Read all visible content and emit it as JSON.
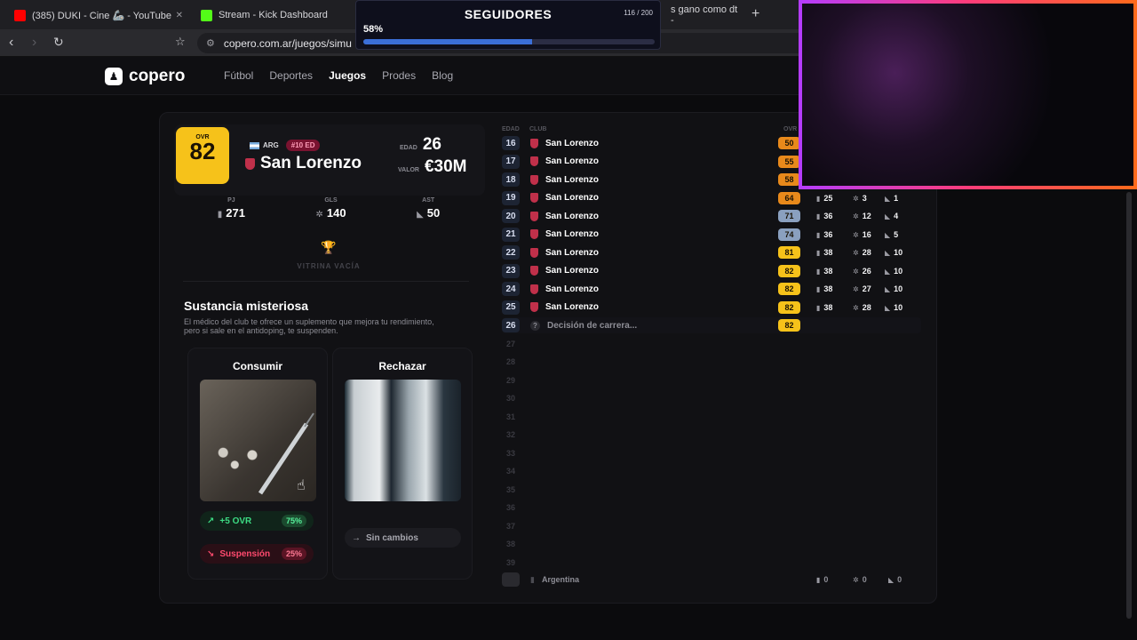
{
  "browser": {
    "tabs": [
      {
        "title": "(385) DUKI - Cine 🦾 - YouTube",
        "color": "#ff0000"
      },
      {
        "title": "Stream - Kick Dashboard",
        "color": "#53fc18"
      },
      {
        "title": "s gano como dt - ",
        "color": "#3a3a41"
      }
    ],
    "url": "copero.com.ar/juegos/simu"
  },
  "overlay": {
    "title": "SEGUIDORES",
    "count": "116 / 200",
    "percent_label": "58%",
    "progress": 0.58
  },
  "site": {
    "logo": "copero",
    "nav": [
      "Fútbol",
      "Deportes",
      "Juegos",
      "Prodes",
      "Blog"
    ],
    "active_nav": "Juegos"
  },
  "player": {
    "ovr_label": "OVR",
    "ovr": "82",
    "country": "ARG",
    "badge": "#10 ED",
    "club": "San Lorenzo",
    "age_label": "EDAD",
    "age": "26",
    "value_label": "VALOR",
    "value": "€30M",
    "stats": [
      {
        "label": "PJ",
        "value": "271",
        "icon": "shirt-icon"
      },
      {
        "label": "GLS",
        "value": "140",
        "icon": "ball-icon"
      },
      {
        "label": "AST",
        "value": "50",
        "icon": "boot-icon"
      }
    ],
    "trophy_case": "VITRINA VACÍA"
  },
  "event": {
    "title": "Sustancia misteriosa",
    "description": "El médico del club te ofrece un suplemento que mejora tu rendimiento, pero si sale en el antidoping, te suspenden.",
    "consume": {
      "label": "Consumir",
      "good": {
        "text": "+5 OVR",
        "pct": "75%"
      },
      "bad": {
        "text": "Suspensión",
        "pct": "25%"
      }
    },
    "reject": {
      "label": "Rechazar",
      "result": "Sin cambios"
    }
  },
  "career": {
    "headers": {
      "age": "EDAD",
      "club": "CLUB",
      "ovr": "OVR"
    },
    "rows": [
      {
        "age": "16",
        "club": "San Lorenzo",
        "ovr": "50",
        "color": "#e8891b"
      },
      {
        "age": "17",
        "club": "San Lorenzo",
        "ovr": "55",
        "color": "#e8891b"
      },
      {
        "age": "18",
        "club": "San Lorenzo",
        "ovr": "58",
        "color": "#e8891b"
      },
      {
        "age": "19",
        "club": "San Lorenzo",
        "ovr": "64",
        "color": "#e8891b",
        "pj": "25",
        "gls": "3",
        "ast": "1"
      },
      {
        "age": "20",
        "club": "San Lorenzo",
        "ovr": "71",
        "color": "#8aa0bf",
        "pj": "36",
        "gls": "12",
        "ast": "4"
      },
      {
        "age": "21",
        "club": "San Lorenzo",
        "ovr": "74",
        "color": "#8aa0bf",
        "pj": "36",
        "gls": "16",
        "ast": "5"
      },
      {
        "age": "22",
        "club": "San Lorenzo",
        "ovr": "81",
        "color": "#f6c21a",
        "pj": "38",
        "gls": "28",
        "ast": "10"
      },
      {
        "age": "23",
        "club": "San Lorenzo",
        "ovr": "82",
        "color": "#f6c21a",
        "pj": "38",
        "gls": "26",
        "ast": "10"
      },
      {
        "age": "24",
        "club": "San Lorenzo",
        "ovr": "82",
        "color": "#f6c21a",
        "pj": "38",
        "gls": "27",
        "ast": "10"
      },
      {
        "age": "25",
        "club": "San Lorenzo",
        "ovr": "82",
        "color": "#f6c21a",
        "pj": "38",
        "gls": "28",
        "ast": "10"
      }
    ],
    "pending": {
      "age": "26",
      "club": "Decisión de carrera...",
      "ovr": "82"
    },
    "future_ages": [
      "27",
      "28",
      "29",
      "30",
      "31",
      "32",
      "33",
      "34",
      "35",
      "36",
      "37",
      "38",
      "39"
    ],
    "national": {
      "team": "Argentina",
      "pj": "0",
      "gls": "0",
      "ast": "0"
    }
  }
}
